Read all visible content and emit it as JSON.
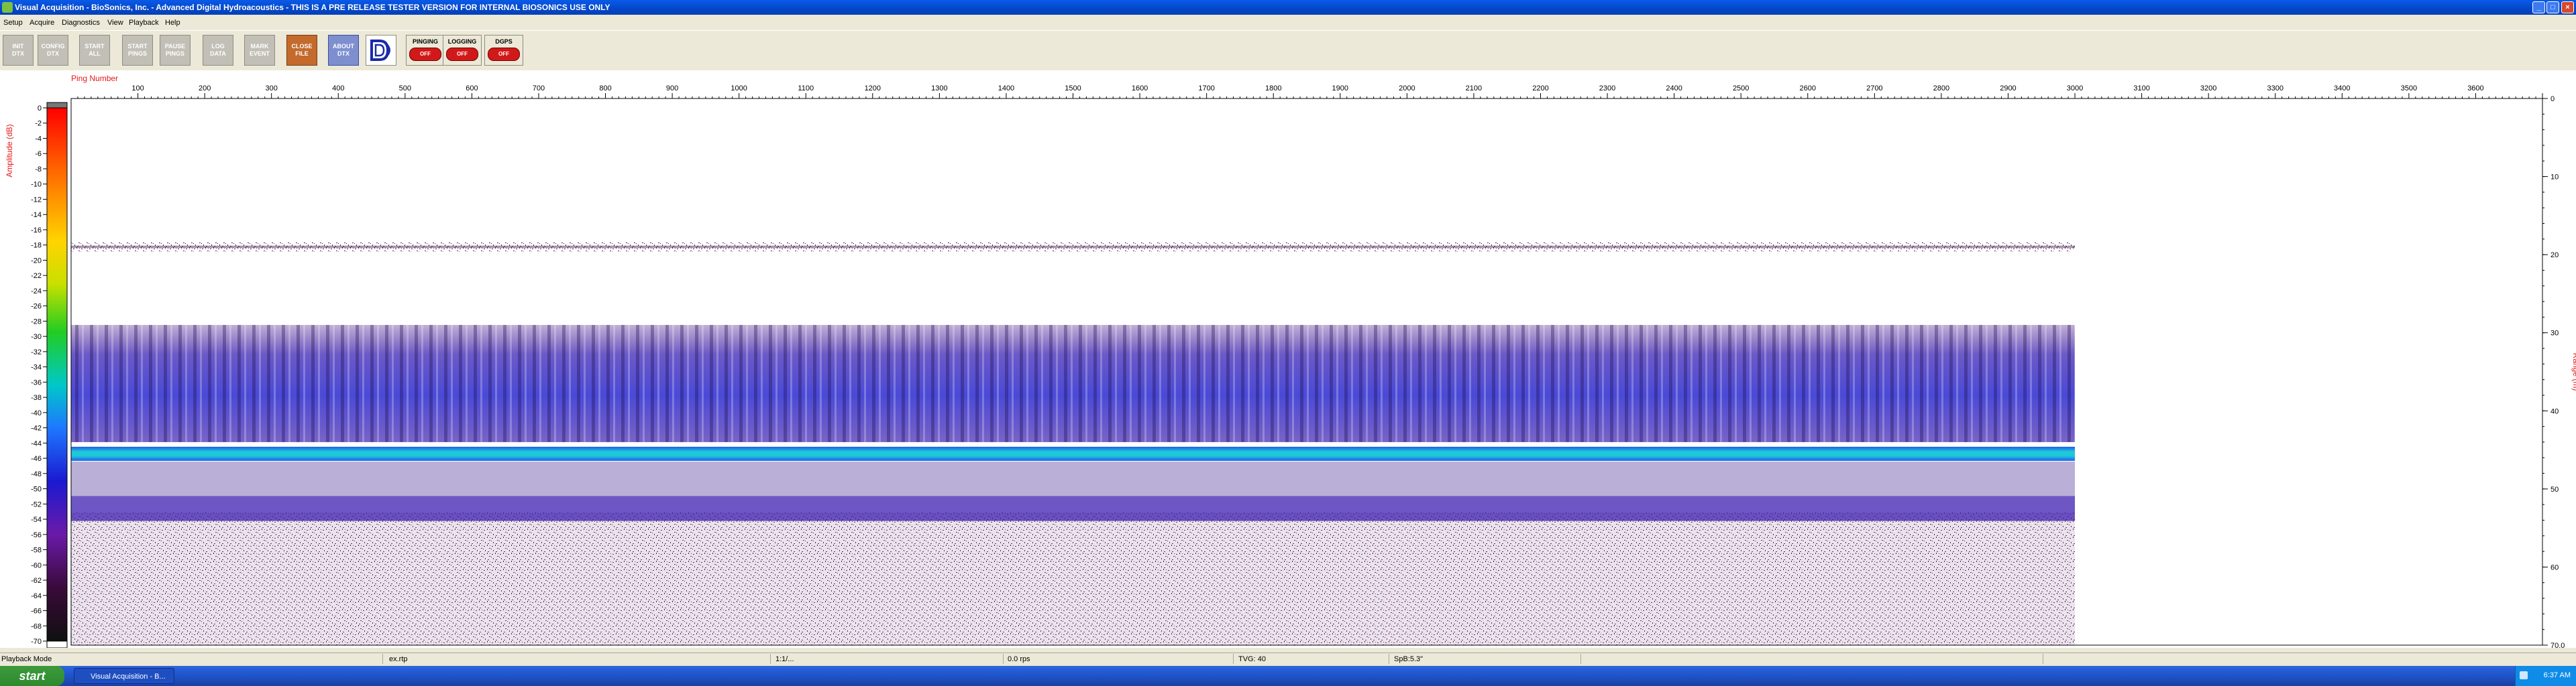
{
  "window": {
    "title": "Visual Acquisition  -  BioSonics, Inc.  -  Advanced Digital Hydroacoustics  -  THIS IS A PRE RELEASE TESTER VERSION FOR INTERNAL BIOSONICS USE ONLY",
    "min_glyph": "_",
    "max_glyph": "□",
    "close_glyph": "×"
  },
  "menu": [
    "Setup",
    "Acquire",
    "Diagnostics",
    "View",
    "Playback",
    "Help"
  ],
  "toolbar": {
    "buttons": [
      {
        "line1": "INIT",
        "line2": "DTX"
      },
      {
        "line1": "CONFIG",
        "line2": "DTX"
      },
      {
        "line1": "START",
        "line2": "ALL"
      },
      {
        "line1": "START",
        "line2": "PINGS"
      },
      {
        "line1": "PAUSE",
        "line2": "PINGS"
      },
      {
        "line1": "LOG",
        "line2": "DATA"
      },
      {
        "line1": "MARK",
        "line2": "EVENT"
      },
      {
        "line1": "CLOSE",
        "line2": "FILE"
      },
      {
        "line1": "ABOUT",
        "line2": "DTX"
      }
    ],
    "logo_icon": "biosonics-logo-icon",
    "indicators": [
      {
        "label": "PINGING",
        "state": "OFF"
      },
      {
        "label": "LOGGING",
        "state": "OFF"
      },
      {
        "label": "DGPS",
        "state": "OFF"
      }
    ]
  },
  "chart_data": {
    "type": "heatmap",
    "title": "",
    "xlabel": "Ping Number",
    "ylabel_left": "Amplitude (dB)",
    "ylabel_right": "Range (m)",
    "xlim": [
      0,
      3700
    ],
    "x_ticks": [
      100,
      200,
      300,
      400,
      500,
      600,
      700,
      800,
      900,
      1000,
      1100,
      1200,
      1300,
      1400,
      1500,
      1600,
      1700,
      1800,
      1900,
      2000,
      2100,
      2200,
      2300,
      2400,
      2500,
      2600,
      2700,
      2800,
      2900,
      3000,
      3100,
      3200,
      3300,
      3400,
      3500,
      3600
    ],
    "range_ticks": [
      0,
      10,
      20,
      30,
      40,
      50,
      60,
      70.0
    ],
    "range_tick_labels": [
      "0",
      "10",
      "20",
      "30",
      "40",
      "50",
      "60",
      "70.0"
    ],
    "ylim_range_m": [
      0,
      70
    ],
    "colorscale_ticks": [
      0,
      -2,
      -4,
      -6,
      -8,
      -10,
      -12,
      -14,
      -16,
      -18,
      -20,
      -22,
      -24,
      -26,
      -28,
      -30,
      -32,
      -34,
      -36,
      -38,
      -40,
      -42,
      -44,
      -46,
      -48,
      -50,
      -52,
      -54,
      -56,
      -58,
      -60,
      -62,
      -64,
      -66,
      -68,
      -70
    ],
    "colorscale_range_db": [
      -70,
      0
    ],
    "pings_recorded": 3000,
    "features": [
      {
        "name": "surface-noise-line",
        "range_m": 19,
        "amplitude_db": -58
      },
      {
        "name": "fish-layer",
        "range_m_top": 29,
        "range_m_bottom": 44,
        "amplitude_db": -44
      },
      {
        "name": "bottom-echo",
        "range_m": 45.5,
        "amplitude_db": -34
      },
      {
        "name": "second-layer",
        "range_m": 52.5,
        "amplitude_db": -50
      },
      {
        "name": "background-noise",
        "range_m_top": 53,
        "range_m_bottom": 70,
        "amplitude_db": -62
      }
    ],
    "colors": {
      "background": "#ffffff",
      "noise": "#5a1a5e",
      "layer": "#3d1fb0",
      "bottom": "#1fc8d8",
      "axis_title": "#e41a1a"
    }
  },
  "status": [
    {
      "text": "Playback Mode"
    },
    {
      "text": "ex.rtp"
    },
    {
      "text": "1:1/..."
    },
    {
      "text": "0.0 rps"
    },
    {
      "text": "TVG: 40"
    },
    {
      "text": "SpB:5.3\""
    },
    {
      "text": ""
    },
    {
      "text": ""
    }
  ],
  "taskbar": {
    "start_label": "start",
    "task_label": "Visual Acquisition - B...",
    "clock": "6:37 AM"
  }
}
